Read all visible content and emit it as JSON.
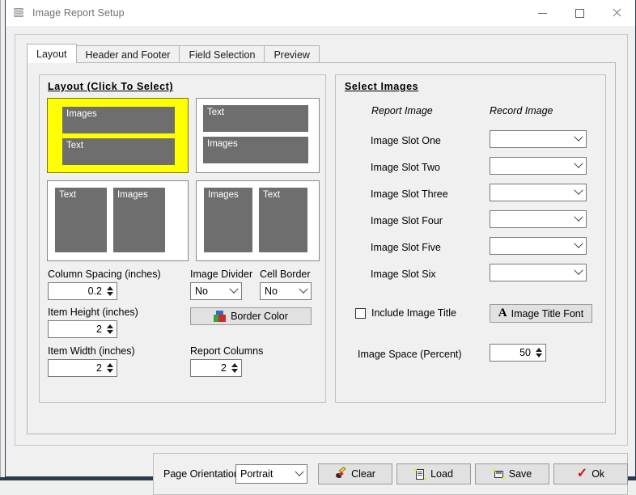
{
  "window": {
    "title": "Image Report Setup",
    "icon": "database-stack-icon",
    "controls": {
      "minimize": "—",
      "maximize": "□",
      "close": "✕"
    }
  },
  "tabs": [
    {
      "label": "Layout",
      "active": true
    },
    {
      "label": "Header and Footer",
      "active": false
    },
    {
      "label": "Field Selection",
      "active": false
    },
    {
      "label": "Preview",
      "active": false
    }
  ],
  "layout_group": {
    "title": "Layout (Click To Select)",
    "options": [
      {
        "id": "stacked-images-top",
        "selected": true,
        "blocks": [
          "Images",
          "Text"
        ],
        "orientation": "vertical"
      },
      {
        "id": "stacked-text-top",
        "selected": false,
        "blocks": [
          "Text",
          "Images"
        ],
        "orientation": "vertical"
      },
      {
        "id": "side-text-left",
        "selected": false,
        "blocks": [
          "Text",
          "Images"
        ],
        "orientation": "horizontal"
      },
      {
        "id": "side-images-left",
        "selected": false,
        "blocks": [
          "Images",
          "Text"
        ],
        "orientation": "horizontal"
      }
    ],
    "fields": {
      "column_spacing_label": "Column Spacing (inches)",
      "column_spacing_value": "0.2",
      "item_height_label": "Item Height (inches)",
      "item_height_value": "2",
      "item_width_label": "Item Width (inches)",
      "item_width_value": "2",
      "image_divider_label": "Image Divider",
      "image_divider_value": "No",
      "cell_border_label": "Cell Border",
      "cell_border_value": "No",
      "border_color_button": "Border Color",
      "report_columns_label": "Report Columns",
      "report_columns_value": "2"
    }
  },
  "select_images_group": {
    "title": "Select Images",
    "col_report_image": "Report Image",
    "col_record_image": "Record Image",
    "slots": [
      {
        "label": "Image Slot One",
        "value": ""
      },
      {
        "label": "Image Slot Two",
        "value": ""
      },
      {
        "label": "Image Slot Three",
        "value": ""
      },
      {
        "label": "Image Slot Four",
        "value": ""
      },
      {
        "label": "Image Slot Five",
        "value": ""
      },
      {
        "label": "Image Slot Six",
        "value": ""
      }
    ],
    "include_image_title_label": "Include Image Title",
    "include_image_title_checked": false,
    "image_title_font_button": "Image Title Font",
    "image_space_label": "Image Space (Percent)",
    "image_space_value": "50"
  },
  "bottom_bar": {
    "page_orientation_label": "Page Orientation",
    "page_orientation_value": "Portrait",
    "clear_button": "Clear",
    "load_button": "Load",
    "save_button": "Save",
    "ok_button": "Ok"
  },
  "colors": {
    "selected_layout": "#ffff00",
    "block_fill": "#6e6e6e",
    "window_border": "#2b3a55",
    "face": "#f0f0f0"
  }
}
